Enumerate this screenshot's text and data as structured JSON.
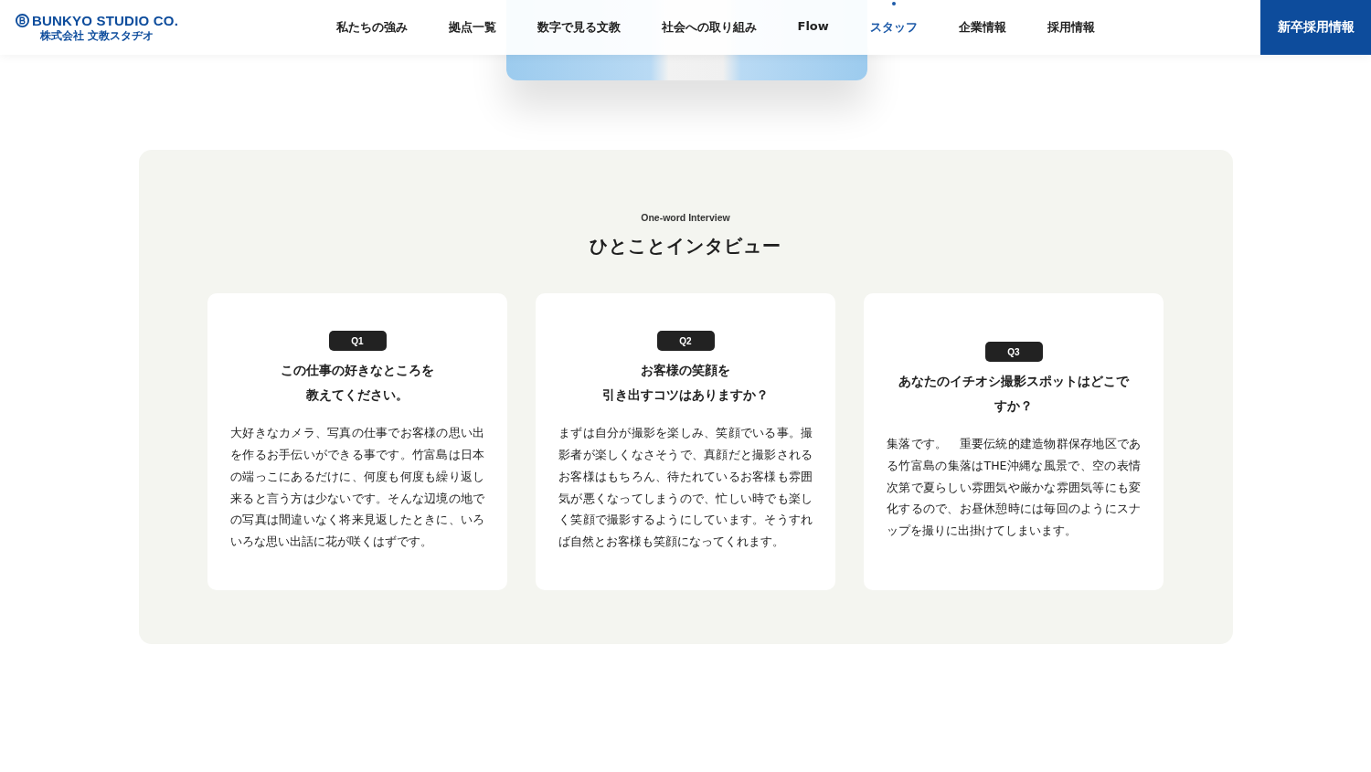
{
  "header": {
    "logo": {
      "name": "BUNKYO STUDIO CO.",
      "subtitle": "株式会社 文教スタヂオ"
    },
    "nav": [
      {
        "label": "私たちの強み",
        "selected": false
      },
      {
        "label": "拠点一覧",
        "selected": false
      },
      {
        "label": "数字で見る文教",
        "selected": false
      },
      {
        "label": "社会への取り組み",
        "selected": false
      },
      {
        "label": "Flow",
        "selected": false
      },
      {
        "label": "スタッフ",
        "selected": true
      },
      {
        "label": "企業情報",
        "selected": false
      },
      {
        "label": "採用情報",
        "selected": false
      }
    ],
    "cta": "新卒採用情報"
  },
  "section": {
    "eyebrow": "One-word Interview",
    "title": "ひとことインタビュー",
    "cards": [
      {
        "badge": "Q1",
        "question_lines": [
          "この仕事の好きなところを",
          "教えてください。"
        ],
        "answer": "大好きなカメラ、写真の仕事でお客様の思い出を作るお手伝いができる事です。竹富島は日本の端っこにあるだけに、何度も何度も繰り返し来ると言う方は少ないです。そんな辺境の地での写真は間違いなく将来見返したときに、いろいろな思い出話に花が咲くはずです。"
      },
      {
        "badge": "Q2",
        "question_lines": [
          "お客様の笑顔を",
          "引き出すコツはありますか？"
        ],
        "answer": "まずは自分が撮影を楽しみ、笑顔でいる事。撮影者が楽しくなさそうで、真顔だと撮影されるお客様はもちろん、待たれているお客様も雰囲気が悪くなってしまうので、忙しい時でも楽しく笑顔で撮影するようにしています。そうすれば自然とお客様も笑顔になってくれます。"
      },
      {
        "badge": "Q3",
        "question_lines": [
          "あなたのイチオシ撮影スポットはどこで",
          "すか？"
        ],
        "answer": "集落です。　重要伝統的建造物群保存地区である竹富島の集落はTHE沖縄な風景で、空の表情次第で夏らしい雰囲気や厳かな雰囲気等にも変化するので、お昼休憩時には毎回のようにスナップを撮りに出掛けてしまいます。"
      }
    ]
  }
}
